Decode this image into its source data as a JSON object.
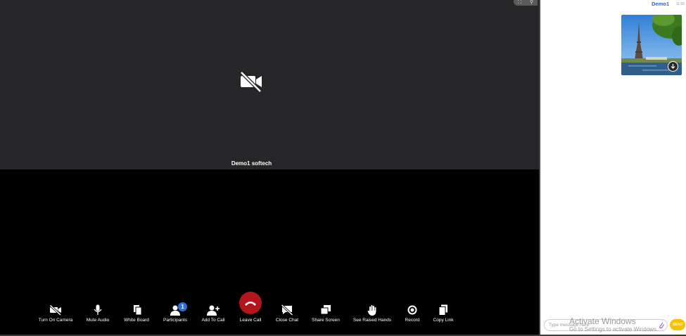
{
  "stage": {
    "participant_name": "Demo1 softech"
  },
  "toolbar": {
    "camera": "Turn On Camera",
    "mute": "Mute Audio",
    "whiteboard": "White Board",
    "participants": "Participants",
    "participants_count": "1",
    "add_to_call": "Add To Call",
    "leave_call": "Leave Call",
    "close_chat": "Close Chat",
    "share_screen": "Share Screen",
    "raised_hands": "See Raised Hands",
    "record": "Record",
    "copy_link": "Copy Link"
  },
  "chat": {
    "message": {
      "sender": "Demo1",
      "time": "11:55",
      "attachment_icon": "image-eiffel-tower"
    },
    "input_placeholder": "Type message here",
    "send_label": "SEND"
  },
  "watermark": {
    "line1": "Activate Windows",
    "line2": "Go to Settings to activate Windows."
  },
  "colors": {
    "tile_bg": "#262628",
    "leave_red": "#b1161c",
    "badge_blue": "#2f6fd6",
    "send_yellow": "#f8c200",
    "sender_blue": "#2a62c9"
  }
}
